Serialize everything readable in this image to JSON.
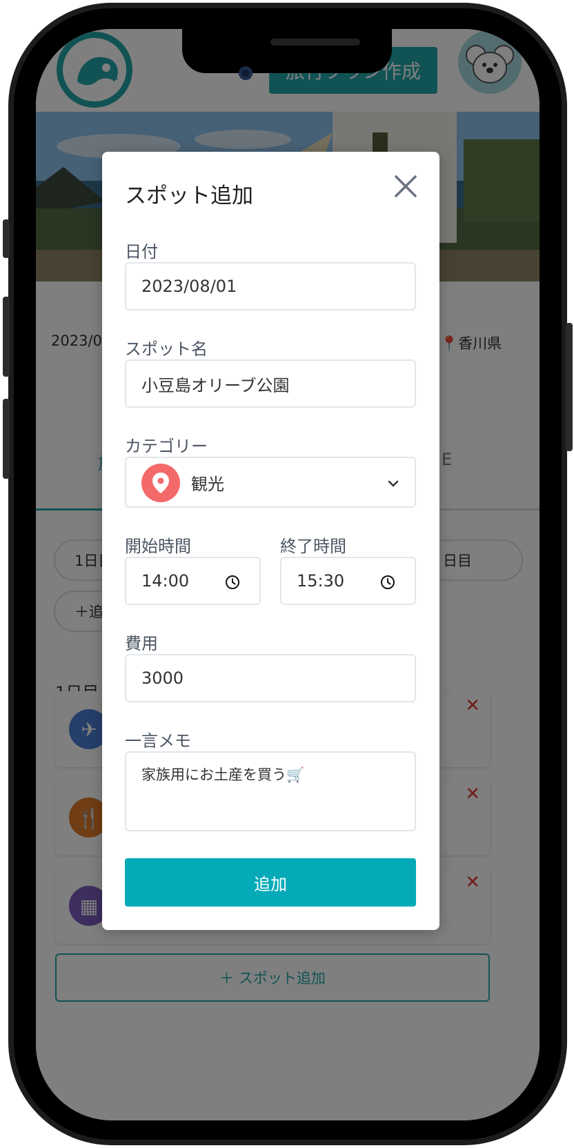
{
  "header": {
    "create_plan_label": "旅行プラン作成",
    "logo_icon": "bird-logo-icon",
    "avatar_icon": "koala-avatar-icon"
  },
  "background_page": {
    "date_partial": "2023/08",
    "prefecture": "香川県",
    "tab_partial_left": "旅",
    "tab_partial_right": "E",
    "day_chip_left": "1日目",
    "day_chip_right": "日目",
    "add_day_chip": "＋追",
    "day_heading": "1日目",
    "spot_icons": [
      "airplane-icon",
      "restaurant-icon",
      "hotel-icon"
    ],
    "spot_icon_colors": [
      "#4a7fd4",
      "#e07b28",
      "#7c5cbf"
    ],
    "add_spot_label": "＋ スポット追加"
  },
  "modal": {
    "title": "スポット追加",
    "date_label": "日付",
    "date_value": "2023/08/01",
    "spot_name_label": "スポット名",
    "spot_name_value": "小豆島オリーブ公園",
    "category_label": "カテゴリー",
    "category_value": "観光",
    "start_time_label": "開始時間",
    "start_time_value": "14:00",
    "end_time_label": "終了時間",
    "end_time_value": "15:30",
    "cost_label": "費用",
    "cost_value": "3000",
    "memo_label": "一言メモ",
    "memo_value": "家族用にお土産を買う🛒",
    "submit_label": "追加"
  },
  "colors": {
    "accent": "#23a6a9",
    "submit": "#05aab8",
    "category_pin": "#f46a6a",
    "delete": "#e53935"
  }
}
